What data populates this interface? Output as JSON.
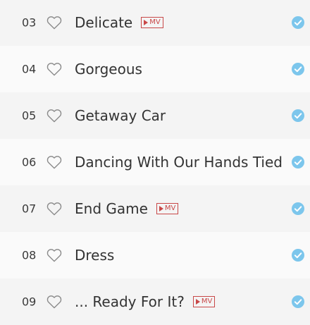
{
  "colors": {
    "accent": "#7cc6ec",
    "mv_badge": "#c84848",
    "row_shaded": "#f4f4f4",
    "row_plain": "#fafafa",
    "heart_outline": "#8a8a8a"
  },
  "icons": {
    "like": "heart-outline-icon",
    "downloaded": "checkmark-circle-icon",
    "mv_play": "play-triangle-icon"
  },
  "tracks": [
    {
      "number": "03",
      "title": "Delicate",
      "mv": "MV"
    },
    {
      "number": "04",
      "title": "Gorgeous",
      "mv": ""
    },
    {
      "number": "05",
      "title": "Getaway Car",
      "mv": ""
    },
    {
      "number": "06",
      "title": "Dancing With Our Hands Tied",
      "mv": ""
    },
    {
      "number": "07",
      "title": "End Game",
      "mv": "MV"
    },
    {
      "number": "08",
      "title": "Dress",
      "mv": ""
    },
    {
      "number": "09",
      "title": "... Ready For It?",
      "mv": "MV"
    }
  ]
}
